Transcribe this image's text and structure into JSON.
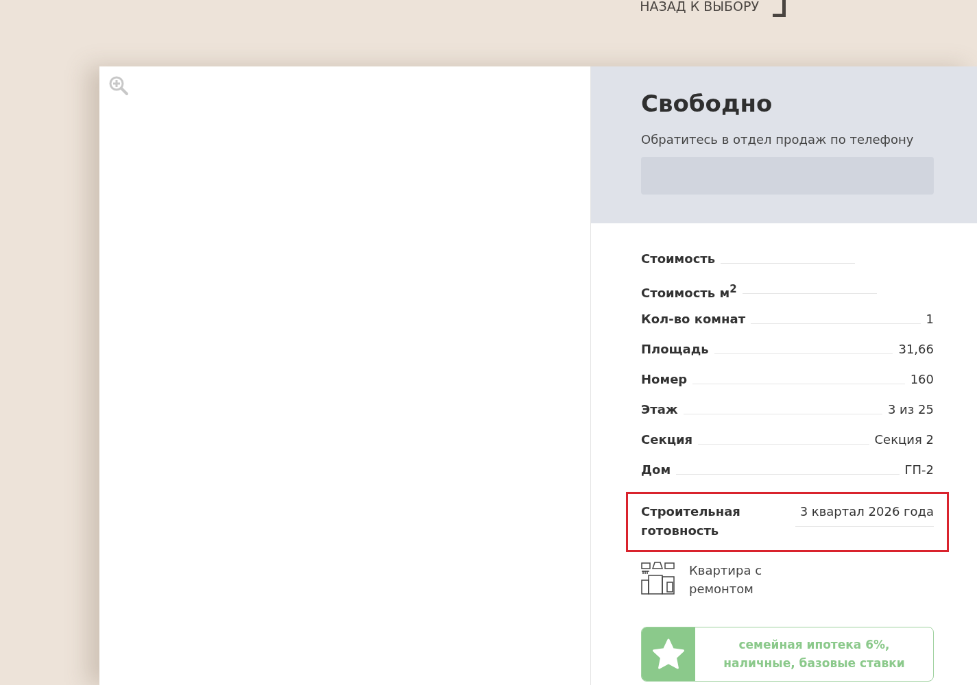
{
  "back_link": {
    "label": "НАЗАД К ВЫБОРУ"
  },
  "status": {
    "title": "Свободно",
    "subtitle": "Обратитесь в отдел продаж по телефону"
  },
  "details": [
    {
      "label": "Стоимость"
    },
    {
      "label": "Стоимость м$^{2}$"
    },
    {
      "label": "Кол-во комнат",
      "value": "1"
    },
    {
      "label": "Площадь",
      "value": "31,66"
    },
    {
      "label": "Номер",
      "value": "160"
    },
    {
      "label": "Этаж",
      "value": "3 из 25"
    },
    {
      "label": "Секция",
      "value": "Секция 2"
    },
    {
      "label": "Дом",
      "value": "ГП-2"
    },
    {
      "label": "Строительная готовность",
      "value": "3 квартал 2026 года",
      "highlighted": true
    }
  ],
  "feature": {
    "label": "Квартира с ремонтом"
  },
  "promo": {
    "text": "семейная ипотека 6%, наличные, базовые ставки"
  }
}
